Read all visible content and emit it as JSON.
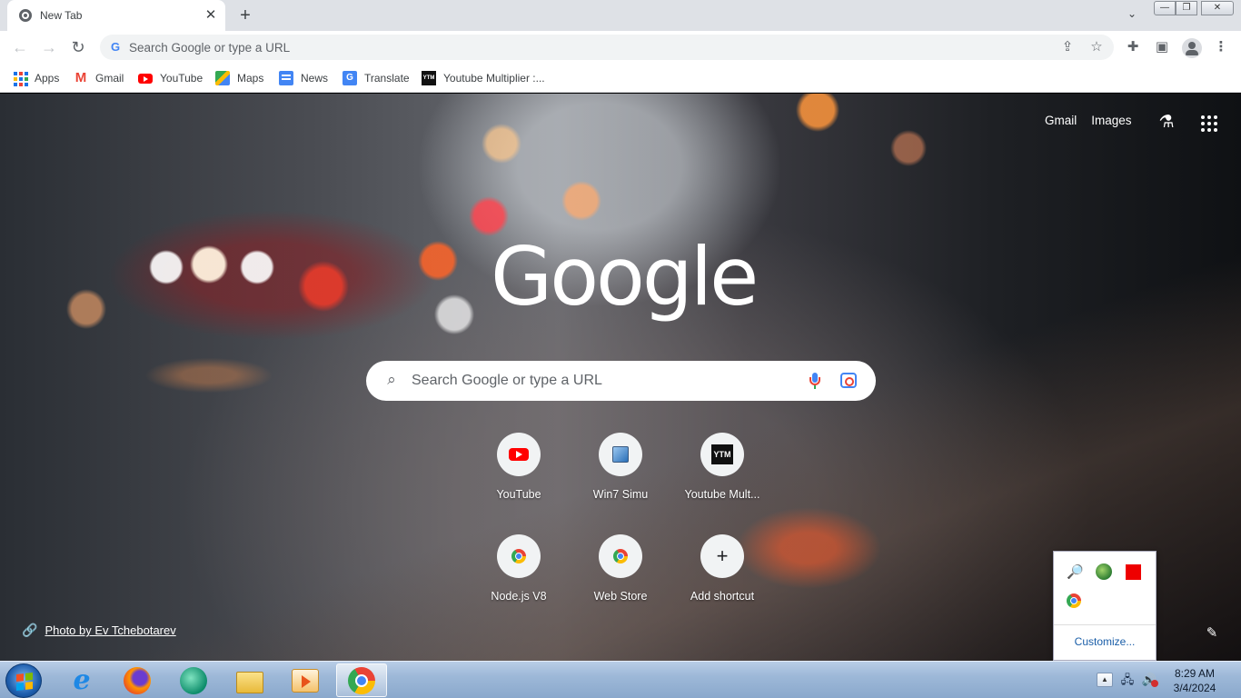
{
  "browser": {
    "tab": {
      "title": "New Tab",
      "close": "✕"
    },
    "new_tab": "+",
    "tab_search": "⌄",
    "window_controls": {
      "minimize": "—",
      "maximize": "❐",
      "close": "✕"
    },
    "nav": {
      "back": "←",
      "forward": "→",
      "reload": "↻"
    },
    "omnibox": {
      "placeholder": "Search Google or type a URL",
      "g_icon": "G"
    },
    "toolbar_icons": {
      "share": "⇪",
      "bookmark": "☆",
      "extensions": "✚",
      "side_panel": "▣",
      "menu": "⋮"
    }
  },
  "bookmarks": [
    {
      "label": "Apps",
      "icon": "apps-grid-icon"
    },
    {
      "label": "Gmail",
      "icon": "gmail-icon"
    },
    {
      "label": "YouTube",
      "icon": "youtube-icon"
    },
    {
      "label": "Maps",
      "icon": "maps-icon"
    },
    {
      "label": "News",
      "icon": "news-icon"
    },
    {
      "label": "Translate",
      "icon": "translate-icon"
    },
    {
      "label": "Youtube Multiplier :...",
      "icon": "ytm-icon"
    }
  ],
  "bookmark_glyphs": {
    "gmail": "M",
    "translate": "G",
    "ytm": "YTM"
  },
  "ntp": {
    "top_links": {
      "gmail": "Gmail",
      "images": "Images"
    },
    "labs_glyph": "⚗",
    "logo": "Google",
    "search": {
      "placeholder": "Search Google or type a URL",
      "icon": "⌕"
    },
    "shortcuts": [
      {
        "title": "YouTube",
        "icon": "youtube-icon"
      },
      {
        "title": "Win7 Simu",
        "icon": "win7-simu-icon"
      },
      {
        "title": "Youtube Mult...",
        "icon": "ytm-icon",
        "glyph": "YTM"
      },
      {
        "title": "Node.js V8",
        "icon": "chrome-icon"
      },
      {
        "title": "Web Store",
        "icon": "chrome-icon"
      },
      {
        "title": "Add shortcut",
        "icon": "plus-icon",
        "glyph": "+"
      }
    ],
    "attribution": {
      "text": "Photo by Ev Tchebotarev",
      "icon": "🔗"
    },
    "edit_glyph": "✎"
  },
  "tray_popup": {
    "icons": [
      "search-tool-icon",
      "globe-icon",
      "red-square-icon",
      "chrome-icon"
    ],
    "search_glyph": "🔎",
    "customize": "Customize..."
  },
  "taskbar": {
    "apps": [
      "internet-explorer-icon",
      "firefox-icon",
      "chat-icon",
      "file-explorer-icon",
      "media-player-icon",
      "chrome-icon"
    ],
    "ie_glyph": "e",
    "tray_up": "▲",
    "net_glyph": "🖧",
    "vol_glyph": "🔊",
    "clock": {
      "time": "8:29 AM",
      "date": "3/4/2024"
    },
    "colors": {
      "flag_red": "#f25022",
      "flag_green": "#7fba00",
      "flag_blue": "#00a4ef",
      "flag_yellow": "#ffb900"
    }
  }
}
